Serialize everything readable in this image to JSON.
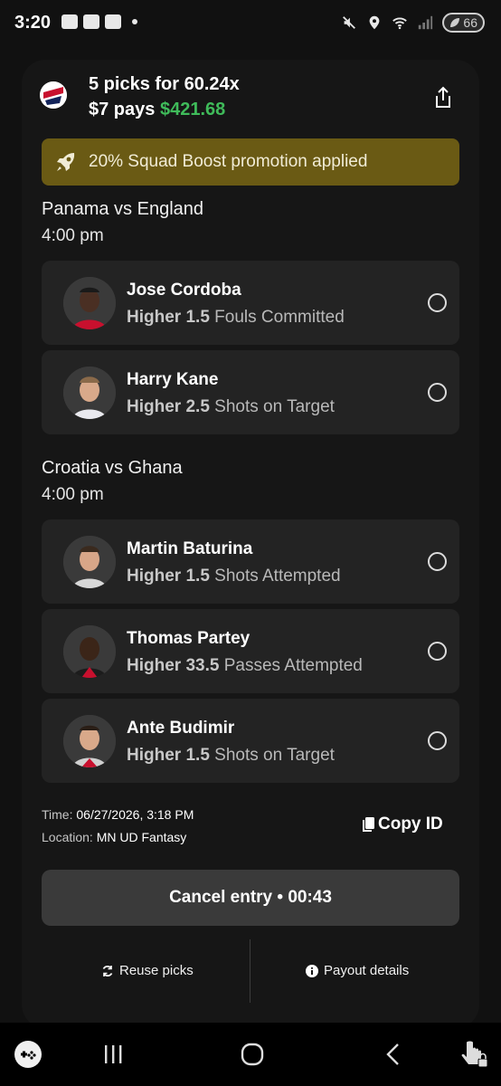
{
  "status_bar": {
    "time": "3:20",
    "battery": "66"
  },
  "entry": {
    "title": "5 picks for 60.24x",
    "pays_prefix": "$7 pays",
    "pays_amount": "$421.68",
    "promo": "20% Squad Boost promotion applied"
  },
  "matches": [
    {
      "title": "Panama vs England",
      "time": "4:00 pm",
      "picks": [
        {
          "player": "Jose Cordoba",
          "direction": "Higher",
          "line": "1.5",
          "stat": "Fouls Committed"
        },
        {
          "player": "Harry Kane",
          "direction": "Higher",
          "line": "2.5",
          "stat": "Shots on Target"
        }
      ]
    },
    {
      "title": "Croatia vs Ghana",
      "time": "4:00 pm",
      "picks": [
        {
          "player": "Martin Baturina",
          "direction": "Higher",
          "line": "1.5",
          "stat": "Shots Attempted"
        },
        {
          "player": "Thomas Partey",
          "direction": "Higher",
          "line": "33.5",
          "stat": "Passes Attempted"
        },
        {
          "player": "Ante Budimir",
          "direction": "Higher",
          "line": "1.5",
          "stat": "Shots on Target"
        }
      ]
    }
  ],
  "meta": {
    "time_label": "Time:",
    "time_value": "06/27/2026, 3:18 PM",
    "location_label": "Location:",
    "location_value": "MN UD Fantasy"
  },
  "actions": {
    "copy_id": "Copy ID",
    "cancel": "Cancel entry • 00:43",
    "reuse": "Reuse picks",
    "payout": "Payout details"
  },
  "colors": {
    "accent_green": "#3fbb5a",
    "promo_bg": "#6a5a14"
  },
  "icons": [
    "share-icon",
    "rocket-icon",
    "copy-icon",
    "refresh-icon",
    "info-icon"
  ]
}
